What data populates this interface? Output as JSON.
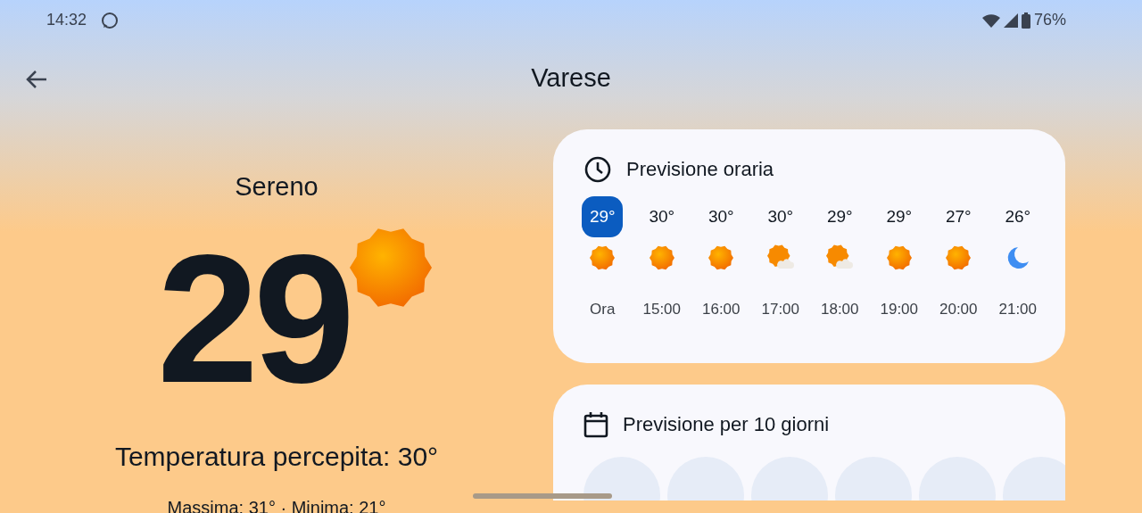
{
  "status_bar": {
    "time": "14:32",
    "battery": "76%"
  },
  "header": {
    "title": "Varese"
  },
  "current": {
    "condition": "Sereno",
    "temperature": "29",
    "feels_like": "Temperatura percepita: 30°",
    "high_low": "Massima: 31° · Minima: 21°"
  },
  "hourly": {
    "title": "Previsione oraria",
    "hours": [
      {
        "temp": "29°",
        "kind": "sun",
        "time": "Ora",
        "selected": true
      },
      {
        "temp": "30°",
        "kind": "sun",
        "time": "15:00",
        "selected": false
      },
      {
        "temp": "30°",
        "kind": "sun",
        "time": "16:00",
        "selected": false
      },
      {
        "temp": "30°",
        "kind": "partly",
        "time": "17:00",
        "selected": false
      },
      {
        "temp": "29°",
        "kind": "partly",
        "time": "18:00",
        "selected": false
      },
      {
        "temp": "29°",
        "kind": "sun",
        "time": "19:00",
        "selected": false
      },
      {
        "temp": "27°",
        "kind": "sun",
        "time": "20:00",
        "selected": false
      },
      {
        "temp": "26°",
        "kind": "moon",
        "time": "21:00",
        "selected": false
      }
    ]
  },
  "daily": {
    "title": "Previsione per 10 giorni",
    "days": [
      {
        "kind": "circle"
      },
      {
        "kind": "circle"
      },
      {
        "kind": "circle"
      },
      {
        "kind": "circle"
      },
      {
        "kind": "circle"
      },
      {
        "kind": "circle"
      }
    ]
  }
}
